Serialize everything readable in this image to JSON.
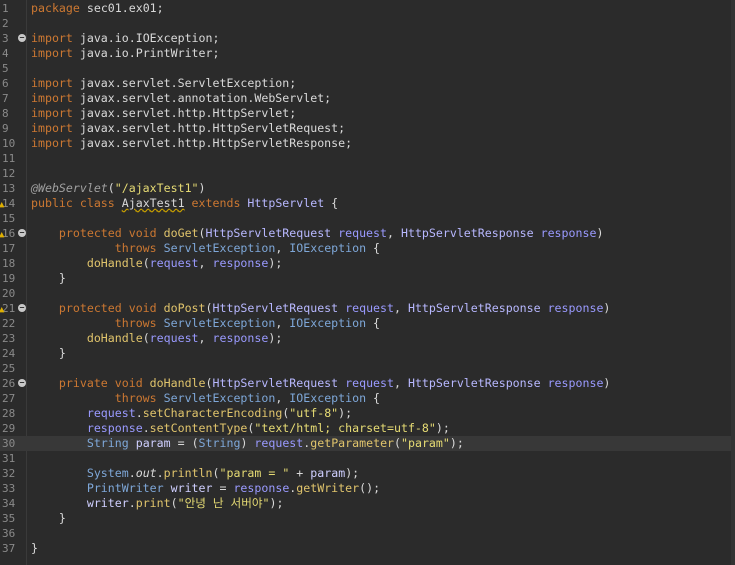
{
  "editor": {
    "language": "java",
    "current_line": 30,
    "lines": [
      {
        "n": "1",
        "tokens": [
          [
            "kw",
            "package"
          ],
          [
            "plain",
            " sec01.ex01;"
          ]
        ]
      },
      {
        "n": "2",
        "tokens": []
      },
      {
        "n": "3",
        "fold": true,
        "tokens": [
          [
            "kw",
            "import"
          ],
          [
            "plain",
            " java.io.IOException;"
          ]
        ]
      },
      {
        "n": "4",
        "tokens": [
          [
            "kw",
            "import"
          ],
          [
            "plain",
            " java.io.PrintWriter;"
          ]
        ]
      },
      {
        "n": "5",
        "tokens": []
      },
      {
        "n": "6",
        "tokens": [
          [
            "kw",
            "import"
          ],
          [
            "plain",
            " javax.servlet.ServletException;"
          ]
        ]
      },
      {
        "n": "7",
        "tokens": [
          [
            "kw",
            "import"
          ],
          [
            "plain",
            " javax.servlet.annotation.WebServlet;"
          ]
        ]
      },
      {
        "n": "8",
        "tokens": [
          [
            "kw",
            "import"
          ],
          [
            "plain",
            " javax.servlet.http.HttpServlet;"
          ]
        ]
      },
      {
        "n": "9",
        "tokens": [
          [
            "kw",
            "import"
          ],
          [
            "plain",
            " javax.servlet.http.HttpServletRequest;"
          ]
        ]
      },
      {
        "n": "10",
        "tokens": [
          [
            "kw",
            "import"
          ],
          [
            "plain",
            " javax.servlet.http.HttpServletResponse;"
          ]
        ]
      },
      {
        "n": "11",
        "tokens": []
      },
      {
        "n": "12",
        "tokens": []
      },
      {
        "n": "13",
        "tokens": [
          [
            "ann",
            "@WebServlet"
          ],
          [
            "plain",
            "("
          ],
          [
            "str",
            "\"/ajaxTest1\""
          ],
          [
            "plain",
            ")"
          ]
        ]
      },
      {
        "n": "14",
        "marker": true,
        "tokens": [
          [
            "kw",
            "public class "
          ],
          [
            "squiggle",
            "AjaxTest1"
          ],
          [
            "kw",
            " extends "
          ],
          [
            "cls",
            "HttpServlet"
          ],
          [
            "plain",
            " {"
          ]
        ]
      },
      {
        "n": "15",
        "tokens": []
      },
      {
        "n": "16",
        "fold": true,
        "marker": true,
        "tokens": [
          [
            "plain",
            "    "
          ],
          [
            "kw",
            "protected void "
          ],
          [
            "meth",
            "doGet"
          ],
          [
            "plain",
            "("
          ],
          [
            "cls",
            "HttpServletRequest "
          ],
          [
            "param",
            "request"
          ],
          [
            "plain",
            ", "
          ],
          [
            "cls",
            "HttpServletResponse "
          ],
          [
            "param",
            "response"
          ],
          [
            "plain",
            ")"
          ]
        ]
      },
      {
        "n": "17",
        "tokens": [
          [
            "plain",
            "            "
          ],
          [
            "kw",
            "throws "
          ],
          [
            "ty",
            "ServletException"
          ],
          [
            "plain",
            ", "
          ],
          [
            "ty",
            "IOException"
          ],
          [
            "plain",
            " {"
          ]
        ]
      },
      {
        "n": "18",
        "tokens": [
          [
            "plain",
            "        "
          ],
          [
            "meth",
            "doHandle"
          ],
          [
            "plain",
            "("
          ],
          [
            "param",
            "request"
          ],
          [
            "plain",
            ", "
          ],
          [
            "param",
            "response"
          ],
          [
            "plain",
            ");"
          ]
        ]
      },
      {
        "n": "19",
        "tokens": [
          [
            "plain",
            "    }"
          ]
        ]
      },
      {
        "n": "20",
        "tokens": []
      },
      {
        "n": "21",
        "fold": true,
        "marker": true,
        "tokens": [
          [
            "plain",
            "    "
          ],
          [
            "kw",
            "protected void "
          ],
          [
            "meth",
            "doPost"
          ],
          [
            "plain",
            "("
          ],
          [
            "cls",
            "HttpServletRequest "
          ],
          [
            "param",
            "request"
          ],
          [
            "plain",
            ", "
          ],
          [
            "cls",
            "HttpServletResponse "
          ],
          [
            "param",
            "response"
          ],
          [
            "plain",
            ")"
          ]
        ]
      },
      {
        "n": "22",
        "tokens": [
          [
            "plain",
            "            "
          ],
          [
            "kw",
            "throws "
          ],
          [
            "ty",
            "ServletException"
          ],
          [
            "plain",
            ", "
          ],
          [
            "ty",
            "IOException"
          ],
          [
            "plain",
            " {"
          ]
        ]
      },
      {
        "n": "23",
        "tokens": [
          [
            "plain",
            "        "
          ],
          [
            "meth",
            "doHandle"
          ],
          [
            "plain",
            "("
          ],
          [
            "param",
            "request"
          ],
          [
            "plain",
            ", "
          ],
          [
            "param",
            "response"
          ],
          [
            "plain",
            ");"
          ]
        ]
      },
      {
        "n": "24",
        "tokens": [
          [
            "plain",
            "    }"
          ]
        ]
      },
      {
        "n": "25",
        "tokens": []
      },
      {
        "n": "26",
        "fold": true,
        "tokens": [
          [
            "plain",
            "    "
          ],
          [
            "kw",
            "private void "
          ],
          [
            "meth",
            "doHandle"
          ],
          [
            "plain",
            "("
          ],
          [
            "cls",
            "HttpServletRequest "
          ],
          [
            "param",
            "request"
          ],
          [
            "plain",
            ", "
          ],
          [
            "cls",
            "HttpServletResponse "
          ],
          [
            "param",
            "response"
          ],
          [
            "plain",
            ")"
          ]
        ]
      },
      {
        "n": "27",
        "tokens": [
          [
            "plain",
            "            "
          ],
          [
            "kw",
            "throws "
          ],
          [
            "ty",
            "ServletException"
          ],
          [
            "plain",
            ", "
          ],
          [
            "ty",
            "IOException"
          ],
          [
            "plain",
            " {"
          ]
        ]
      },
      {
        "n": "28",
        "tokens": [
          [
            "plain",
            "        "
          ],
          [
            "param",
            "request"
          ],
          [
            "plain",
            "."
          ],
          [
            "meth",
            "setCharacterEncoding"
          ],
          [
            "plain",
            "("
          ],
          [
            "str",
            "\"utf-8\""
          ],
          [
            "plain",
            ");"
          ]
        ]
      },
      {
        "n": "29",
        "tokens": [
          [
            "plain",
            "        "
          ],
          [
            "param",
            "response"
          ],
          [
            "plain",
            "."
          ],
          [
            "meth",
            "setContentType"
          ],
          [
            "plain",
            "("
          ],
          [
            "str",
            "\"text/html; charset=utf-8\""
          ],
          [
            "plain",
            ");"
          ]
        ]
      },
      {
        "n": "30",
        "tokens": [
          [
            "plain",
            "        "
          ],
          [
            "ty",
            "String "
          ],
          [
            "var",
            "param"
          ],
          [
            "plain",
            " = ("
          ],
          [
            "ty",
            "String"
          ],
          [
            "plain",
            ") "
          ],
          [
            "param",
            "request"
          ],
          [
            "plain",
            "."
          ],
          [
            "meth",
            "getParameter"
          ],
          [
            "plain",
            "("
          ],
          [
            "str",
            "\"param\""
          ],
          [
            "plain",
            ");"
          ]
        ]
      },
      {
        "n": "31",
        "tokens": []
      },
      {
        "n": "32",
        "tokens": [
          [
            "plain",
            "        "
          ],
          [
            "ty",
            "System"
          ],
          [
            "plain",
            "."
          ],
          [
            "italic",
            "out"
          ],
          [
            "plain",
            "."
          ],
          [
            "meth",
            "println"
          ],
          [
            "plain",
            "("
          ],
          [
            "str",
            "\"param = \""
          ],
          [
            "plain",
            " + "
          ],
          [
            "var",
            "param"
          ],
          [
            "plain",
            ");"
          ]
        ]
      },
      {
        "n": "33",
        "tokens": [
          [
            "plain",
            "        "
          ],
          [
            "ty",
            "PrintWriter "
          ],
          [
            "var",
            "writer"
          ],
          [
            "plain",
            " = "
          ],
          [
            "param",
            "response"
          ],
          [
            "plain",
            "."
          ],
          [
            "meth",
            "getWriter"
          ],
          [
            "plain",
            "();"
          ]
        ]
      },
      {
        "n": "34",
        "tokens": [
          [
            "plain",
            "        "
          ],
          [
            "var",
            "writer"
          ],
          [
            "plain",
            "."
          ],
          [
            "meth",
            "print"
          ],
          [
            "plain",
            "("
          ],
          [
            "str",
            "\"안녕 난 서버야\""
          ],
          [
            "plain",
            ");"
          ]
        ]
      },
      {
        "n": "35",
        "tokens": [
          [
            "plain",
            "    }"
          ]
        ]
      },
      {
        "n": "36",
        "tokens": []
      },
      {
        "n": "37",
        "tokens": [
          [
            "plain",
            "}"
          ]
        ]
      }
    ]
  }
}
